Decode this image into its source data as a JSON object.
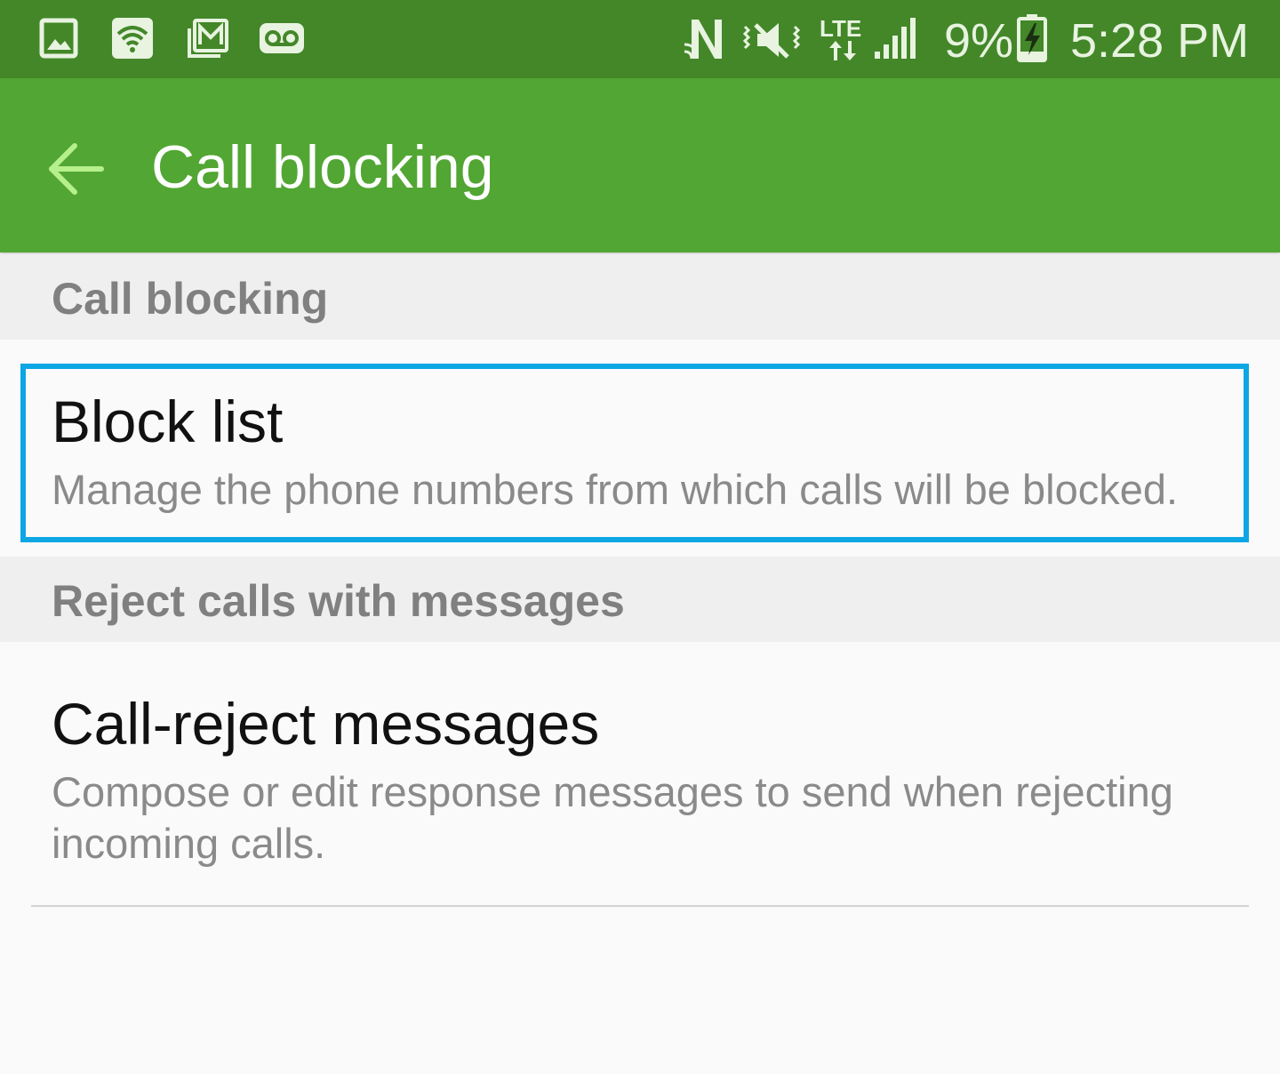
{
  "status_bar": {
    "battery_percent": "9%",
    "time": "5:28 PM",
    "network_label": "LTE",
    "left_icons": [
      "gallery-icon",
      "wifi-icon",
      "gmail-icon",
      "voicemail-icon"
    ],
    "right_icons": [
      "nfc-icon",
      "mute-vibrate-icon",
      "lte-data-icon",
      "signal-icon",
      "battery-charging-icon"
    ],
    "color": "#438729"
  },
  "app_bar": {
    "title": "Call blocking",
    "back_icon": "arrow-left-icon",
    "color": "#52a633",
    "back_icon_color": "#b6f08c"
  },
  "sections": [
    {
      "header": "Call blocking",
      "items": [
        {
          "title": "Block list",
          "summary": "Manage the phone numbers from which calls will be blocked.",
          "focused": true
        }
      ]
    },
    {
      "header": "Reject calls with messages",
      "items": [
        {
          "title": "Call-reject messages",
          "summary": "Compose or edit response messages to send when rejecting incoming calls.",
          "focused": false
        }
      ]
    }
  ],
  "focus_color": "#0ca6e4"
}
